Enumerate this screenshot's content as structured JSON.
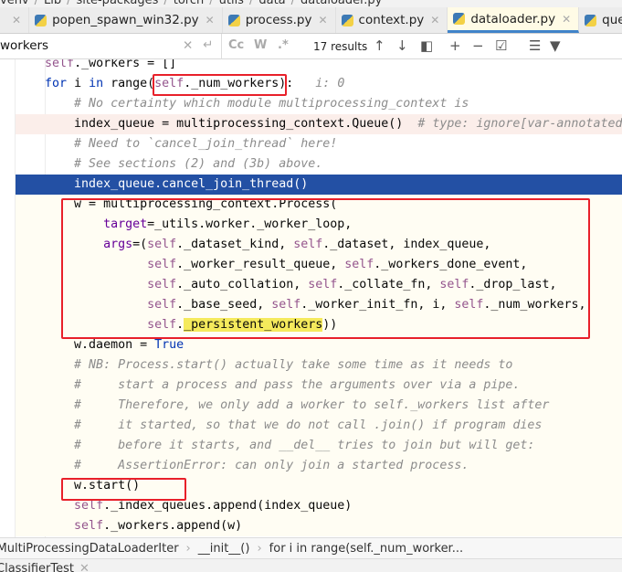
{
  "path_breadcrumb": [
    "venv",
    "Lib",
    "site-packages",
    "torch",
    "utils",
    "data",
    "dataloader.py"
  ],
  "tabs": [
    {
      "label": "popen_spawn_win32.py",
      "active": false
    },
    {
      "label": "process.py",
      "active": false
    },
    {
      "label": "context.py",
      "active": false
    },
    {
      "label": "dataloader.py",
      "active": true
    },
    {
      "label": "queues.py",
      "active": false
    }
  ],
  "search": {
    "query": "workers",
    "match_case": "Cc",
    "words": "W",
    "regex": ".*",
    "results": "17 results"
  },
  "code": {
    "lines": [
      [
        [
          "",
          "    "
        ],
        [
          "self",
          "self"
        ],
        [
          "",
          "._workers = []"
        ]
      ],
      [
        [
          "",
          "    "
        ],
        [
          "kw",
          "for"
        ],
        [
          "",
          " i "
        ],
        [
          "kw",
          "in"
        ],
        [
          "",
          " range("
        ],
        [
          "self",
          "self"
        ],
        [
          "",
          "._num_workers):"
        ],
        [
          "hint",
          "   i: 0"
        ]
      ],
      [
        [
          "cm",
          "        # No certainty which module multiprocessing_context is"
        ]
      ],
      [
        [
          "",
          "        index_queue = multiprocessing_context.Queue()  "
        ],
        [
          "cm",
          "# type: ignore[var-annotated]"
        ]
      ],
      [
        [
          "cm",
          "        # Need to `cancel_join_thread` here!"
        ]
      ],
      [
        [
          "cm",
          "        # See sections (2) and (3b) above."
        ]
      ],
      [
        [
          "",
          "        index_queue.cancel_join_thread()"
        ]
      ],
      [
        [
          "",
          "        w = multiprocessing_context.Process("
        ]
      ],
      [
        [
          "",
          "            "
        ],
        [
          "kwarg",
          "target"
        ],
        [
          "",
          "=_utils.worker._worker_loop,"
        ]
      ],
      [
        [
          "",
          "            "
        ],
        [
          "kwarg",
          "args"
        ],
        [
          "",
          "=("
        ],
        [
          "self",
          "self"
        ],
        [
          "",
          "._dataset_kind, "
        ],
        [
          "self",
          "self"
        ],
        [
          "",
          "._dataset, index_queue,"
        ]
      ],
      [
        [
          "",
          "                  "
        ],
        [
          "self",
          "self"
        ],
        [
          "",
          "._worker_result_queue, "
        ],
        [
          "self",
          "self"
        ],
        [
          "",
          "._workers_done_event,"
        ]
      ],
      [
        [
          "",
          "                  "
        ],
        [
          "self",
          "self"
        ],
        [
          "",
          "._auto_collation, "
        ],
        [
          "self",
          "self"
        ],
        [
          "",
          "._collate_fn, "
        ],
        [
          "self",
          "self"
        ],
        [
          "",
          "._drop_last,"
        ]
      ],
      [
        [
          "",
          "                  "
        ],
        [
          "self",
          "self"
        ],
        [
          "",
          "._base_seed, "
        ],
        [
          "self",
          "self"
        ],
        [
          "",
          "._worker_init_fn, i, "
        ],
        [
          "self",
          "self"
        ],
        [
          "",
          "._num_workers,"
        ]
      ],
      [
        [
          "",
          "                  "
        ],
        [
          "self",
          "self"
        ],
        [
          "",
          "."
        ],
        [
          "match",
          "_persistent_workers"
        ],
        [
          "",
          "))"
        ]
      ],
      [
        [
          "",
          "        w.daemon = "
        ],
        [
          "kw",
          "True"
        ]
      ],
      [
        [
          "cm",
          "        # NB: Process.start() actually take some time as it needs to"
        ]
      ],
      [
        [
          "cm",
          "        #     start a process and pass the arguments over via a pipe."
        ]
      ],
      [
        [
          "cm",
          "        #     Therefore, we only add a worker to self._workers list after"
        ]
      ],
      [
        [
          "cm",
          "        #     it started, so that we do not call .join() if program dies"
        ]
      ],
      [
        [
          "cm",
          "        #     before it starts, and __del__ tries to join but will get:"
        ]
      ],
      [
        [
          "cm",
          "        #     AssertionError: can only join a started process."
        ]
      ],
      [
        [
          "",
          "        w.start()"
        ]
      ],
      [
        [
          "",
          "        "
        ],
        [
          "self",
          "self"
        ],
        [
          "",
          "._index_queues.append(index_queue)"
        ]
      ],
      [
        [
          "",
          "        "
        ],
        [
          "self",
          "self"
        ],
        [
          "",
          "._workers.append(w)"
        ]
      ]
    ],
    "error_line": 4,
    "selected_line": 7
  },
  "structure_breadcrumb": [
    "_MultiProcessingDataLoaderIter",
    "__init__()",
    "for i in range(self._num_worker..."
  ],
  "bottom_tab": {
    "label": "ClassifierTest"
  },
  "colors": {
    "accent": "#4083c9",
    "selection": "#2350a4",
    "annotation_box": "#e8202a",
    "match": "#f5ea5c"
  }
}
